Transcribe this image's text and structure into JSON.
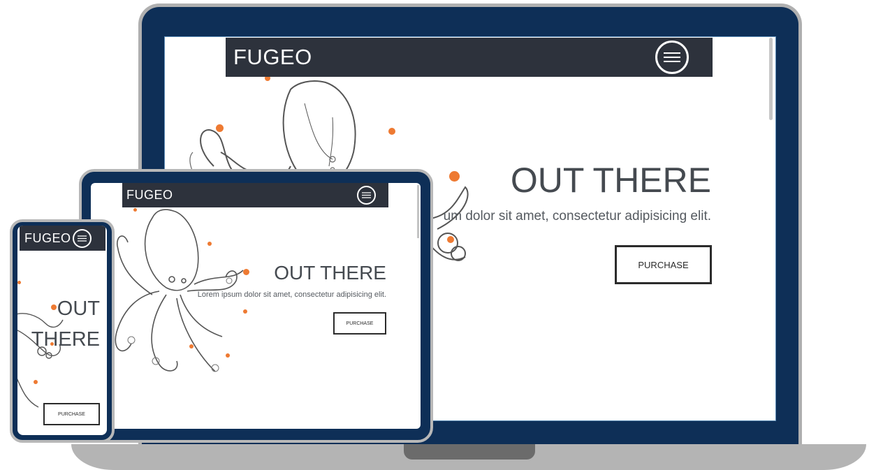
{
  "site": {
    "brand": "FUGEO",
    "hero_title": "OUT THERE",
    "hero_title_phone_line1": "OUT",
    "hero_title_phone_line2": "THERE",
    "hero_subtitle_laptop": "um dolor sit amet, consectetur adipisicing elit.",
    "hero_subtitle_tablet": "Lorem ipsum dolor sit amet, consectetur adipisicing elit.",
    "purchase_label": "PURCHASE"
  },
  "colors": {
    "device_frame": "#0e2f57",
    "navbar": "#2d323c",
    "accent_dots": "#ee7a32",
    "title_text": "#454a50"
  },
  "icons": {
    "menu": "hamburger-menu-icon",
    "illustration": "octopus-illustration"
  }
}
